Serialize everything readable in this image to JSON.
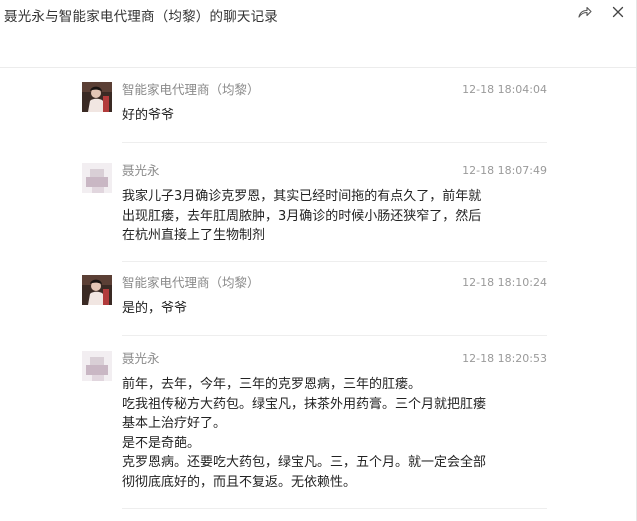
{
  "window": {
    "title": "聂光永与智能家电代理商（均黎）的聊天记录",
    "share_icon": "share-arrow-icon",
    "close_icon": "close-icon"
  },
  "messages": [
    {
      "sender": "智能家电代理商（均黎）",
      "time": "12-18 18:04:04",
      "avatar": "photo-avatar",
      "text": "好的爷爷"
    },
    {
      "sender": "聂光永",
      "time": "12-18 18:07:49",
      "avatar": "blurred-avatar",
      "text": "我家儿子3月确诊克罗恩，其实已经时间拖的有点久了，前年就\n出现肛瘘，去年肛周脓肿，3月确诊的时候小肠还狭窄了，然后\n在杭州直接上了生物制剂"
    },
    {
      "sender": "智能家电代理商（均黎）",
      "time": "12-18 18:10:24",
      "avatar": "photo-avatar",
      "text": "是的，爷爷"
    },
    {
      "sender": "聂光永",
      "time": "12-18 18:20:53",
      "avatar": "blurred-avatar",
      "text": "前年，去年，今年，三年的克罗恩病，三年的肛瘘。\n吃我祖传秘方大药包。绿宝凡，抹茶外用药膏。三个月就把肛瘘\n基本上治疗好了。\n是不是奇葩。\n克罗恩病。还要吃大药包，绿宝凡。三，五个月。就一定会全部\n彻彻底底好的，而且不复返。无依赖性。"
    }
  ]
}
